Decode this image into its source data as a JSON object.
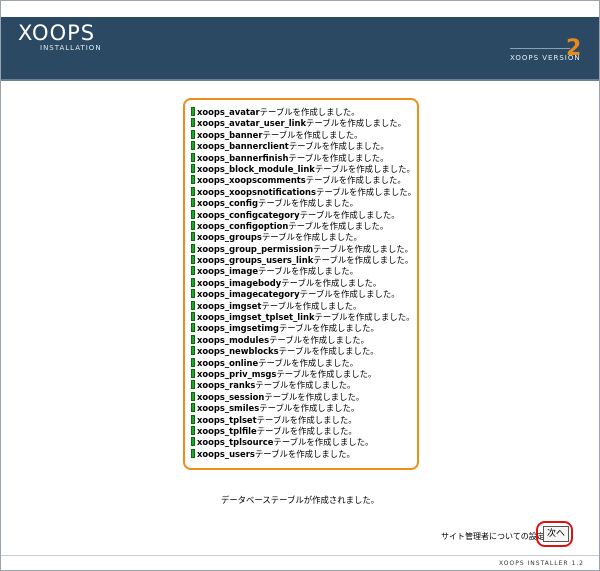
{
  "header": {
    "logo_main": "XOOPS",
    "logo_sub": "INSTALLATION",
    "version_label": "XOOPS VERSION",
    "version_number": "2"
  },
  "log": {
    "suffix": "テーブルを作成しました。",
    "tables": [
      "xoops_avatar",
      "xoops_avatar_user_link",
      "xoops_banner",
      "xoops_bannerclient",
      "xoops_bannerfinish",
      "xoops_block_module_link",
      "xoops_xoopscomments",
      "xoops_xoopsnotifications",
      "xoops_config",
      "xoops_configcategory",
      "xoops_configoption",
      "xoops_groups",
      "xoops_group_permission",
      "xoops_groups_users_link",
      "xoops_image",
      "xoops_imagebody",
      "xoops_imagecategory",
      "xoops_imgset",
      "xoops_imgset_tplset_link",
      "xoops_imgsetimg",
      "xoops_modules",
      "xoops_newblocks",
      "xoops_online",
      "xoops_priv_msgs",
      "xoops_ranks",
      "xoops_session",
      "xoops_smiles",
      "xoops_tplset",
      "xoops_tplfile",
      "xoops_tplsource",
      "xoops_users"
    ]
  },
  "status_message": "データベーステーブルが作成されました。",
  "navigation": {
    "next_hint": "サイト管理者についての設定 >>",
    "next_button": "次へ"
  },
  "footer": {
    "text": "XOOPS INSTALLER 1.2"
  },
  "colors": {
    "header_bg": "#2c4963",
    "accent_orange": "#f08c1a",
    "ok_green": "#22a32a",
    "highlight_red": "#dd1111"
  }
}
